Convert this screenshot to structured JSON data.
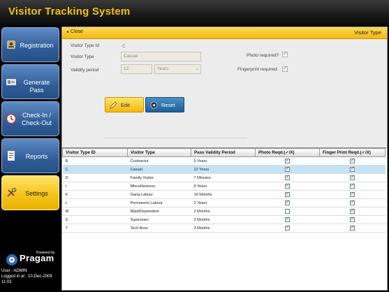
{
  "app": {
    "title": "Visitor Tracking System"
  },
  "sidebar": {
    "items": [
      {
        "label": "Registration",
        "icon": "registration-icon",
        "active": false
      },
      {
        "label": "Generate Pass",
        "icon": "pass-icon",
        "active": false
      },
      {
        "label": "Check-In / Check-Out",
        "icon": "clock-icon",
        "active": false
      },
      {
        "label": "Reports",
        "icon": "report-icon",
        "active": false
      },
      {
        "label": "Settings",
        "icon": "tools-icon",
        "active": true
      }
    ],
    "powered_by": "Powered by",
    "brand": "Pragam",
    "user_line": "User : ADMIN",
    "logged_in_line": "Logged in at : 10-Dec-2009",
    "logged_in_time": "11:03"
  },
  "header": {
    "close_label": "Close",
    "page_title": "Visitor Type"
  },
  "form": {
    "visitor_type_id_label": "Visitor Type Id",
    "visitor_type_id_value": "C",
    "visitor_type_label": "Visitor Type",
    "visitor_type_value": "Casual",
    "validity_period_label": "Validity period",
    "validity_period_value": "12",
    "validity_unit_value": "Years",
    "photo_required_label": "Photo required?",
    "photo_required_checked": true,
    "fingerprint_required_label": "Fingerprint required",
    "fingerprint_required_checked": true,
    "edit_label": "Edit",
    "reset_label": "Reset"
  },
  "table": {
    "headers": [
      "Visitor Type ID",
      "Visitor Type",
      "Pass Validity Period",
      "Photo Reqd.(✓/X)",
      "Finger Print Reqd.(✓/X)"
    ],
    "rows": [
      {
        "id": "B",
        "type": "Contractor",
        "validity": "5 Years",
        "photo": true,
        "finger": true,
        "selected": false
      },
      {
        "id": "C",
        "type": "Casual",
        "validity": "12 Years",
        "photo": true,
        "finger": true,
        "selected": true
      },
      {
        "id": "D",
        "type": "Family Visitor",
        "validity": "7 Minutes",
        "photo": true,
        "finger": true,
        "selected": false
      },
      {
        "id": "I",
        "type": "Miscellaneous",
        "validity": "6 Years",
        "photo": true,
        "finger": true,
        "selected": false
      },
      {
        "id": "K",
        "type": "Gang Labour",
        "validity": "16 Months",
        "photo": true,
        "finger": true,
        "selected": false
      },
      {
        "id": "L",
        "type": "Permanent Labour",
        "validity": "2 Years",
        "photo": true,
        "finger": true,
        "selected": false
      },
      {
        "id": "M",
        "type": "Maid/Dependent",
        "validity": "2 Months",
        "photo": false,
        "finger": true,
        "selected": false
      },
      {
        "id": "S",
        "type": "Supervisor",
        "validity": "3 Months",
        "photo": true,
        "finger": true,
        "selected": false
      },
      {
        "id": "T",
        "type": "Tech Area",
        "validity": "3 Months",
        "photo": true,
        "finger": true,
        "selected": false
      }
    ]
  },
  "colors": {
    "accent": "#f3b90f",
    "title_text": "#f2c200",
    "nav_blue": "#2f5d98",
    "selected_row": "#c6e3f6"
  }
}
